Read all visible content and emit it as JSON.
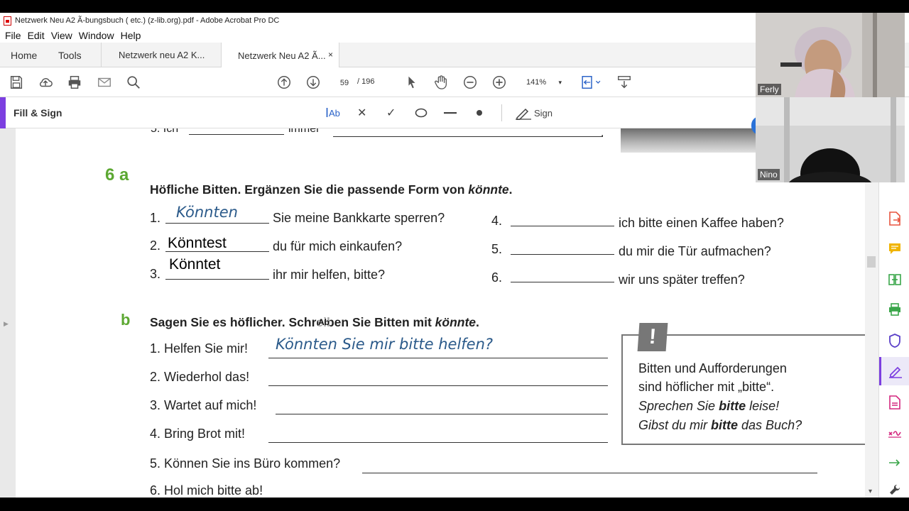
{
  "window": {
    "title": "Netzwerk Neu A2 Ã-bungsbuch ( etc.) (z-lib.org).pdf - Adobe Acrobat Pro DC"
  },
  "menu": [
    "File",
    "Edit",
    "View",
    "Window",
    "Help"
  ],
  "tabs": {
    "home": "Home",
    "tools": "Tools",
    "doc1": "Netzwerk neu A2 K...",
    "doc2": "Netzwerk Neu A2 Ã...",
    "close": "×"
  },
  "toolbar": {
    "page_current": "59",
    "page_total": "/  196",
    "zoom": "141%",
    "zoom_caret": "▾"
  },
  "fill_sign": {
    "title": "Fill & Sign",
    "text_tool": "Ab",
    "cross": "✕",
    "check": "✓",
    "sign": "Sign"
  },
  "document": {
    "exercise_a_number": "6 a",
    "exercise_a_heading_pre": "Höfliche Bitten. Ergänzen Sie die passende Form von ",
    "exercise_a_heading_word": "könnte",
    "exercise_a_heading_post": ".",
    "prev_line_start": "5. Ich",
    "prev_line_mid": "immer",
    "prev_line_end": ".",
    "items_a": [
      {
        "n": "1.",
        "answer": "Könnten",
        "text": "Sie meine Bankkarte sperren?"
      },
      {
        "n": "2.",
        "answer": "Könntest",
        "text": "du für mich einkaufen?"
      },
      {
        "n": "3.",
        "answer": "Könntet",
        "text": "ihr mir helfen, bitte?"
      },
      {
        "n": "4.",
        "answer": "",
        "text": "ich bitte einen Kaffee haben?"
      },
      {
        "n": "5.",
        "answer": "",
        "text": "du mir die Tür aufmachen?"
      },
      {
        "n": "6.",
        "answer": "",
        "text": "wir uns später treffen?"
      }
    ],
    "exercise_b_letter": "b",
    "exercise_b_heading_pre": "Sagen Sie es höflicher. Schreiben Sie Bitten mit ",
    "exercise_b_heading_word": "könnte",
    "exercise_b_heading_post": ".",
    "items_b": [
      {
        "text": "1. Helfen Sie mir!",
        "answer": "Könnten Sie mir bitte helfen?"
      },
      {
        "text": "2. Wiederhol das!",
        "answer": ""
      },
      {
        "text": "3. Wartet auf mich!",
        "answer": ""
      },
      {
        "text": "4. Bring Brot mit!",
        "answer": ""
      },
      {
        "text": "5. Können Sie ins Büro kommen?",
        "answer": ""
      },
      {
        "text": "6. Hol mich bitte ab!",
        "answer": ""
      }
    ],
    "cursor_label": "Ab",
    "infobox": {
      "mark": "!",
      "line1": "Bitten und Aufforderungen",
      "line2": "sind höflicher mit „bitte“.",
      "line3_pre": "Sprechen Sie ",
      "line3_bold": "bitte",
      "line3_post": " leise!",
      "line4_pre": "Gibst du mir ",
      "line4_bold": "bitte",
      "line4_post": " das Buch?"
    }
  },
  "participants": [
    {
      "name": "Ferly"
    },
    {
      "name": "Nino"
    }
  ],
  "colors": {
    "accent_purple": "#7c3fe0",
    "exercise_green": "#5ca832",
    "handwriting_blue": "#2b5a8a",
    "right_panel_icons": [
      "#e8543e",
      "#f0b400",
      "#3aa64a",
      "#3aa64a",
      "#5a3fc8",
      "#7c3fe0",
      "#d4277f",
      "#d4277f",
      "#3aa64a",
      "#444444"
    ]
  }
}
